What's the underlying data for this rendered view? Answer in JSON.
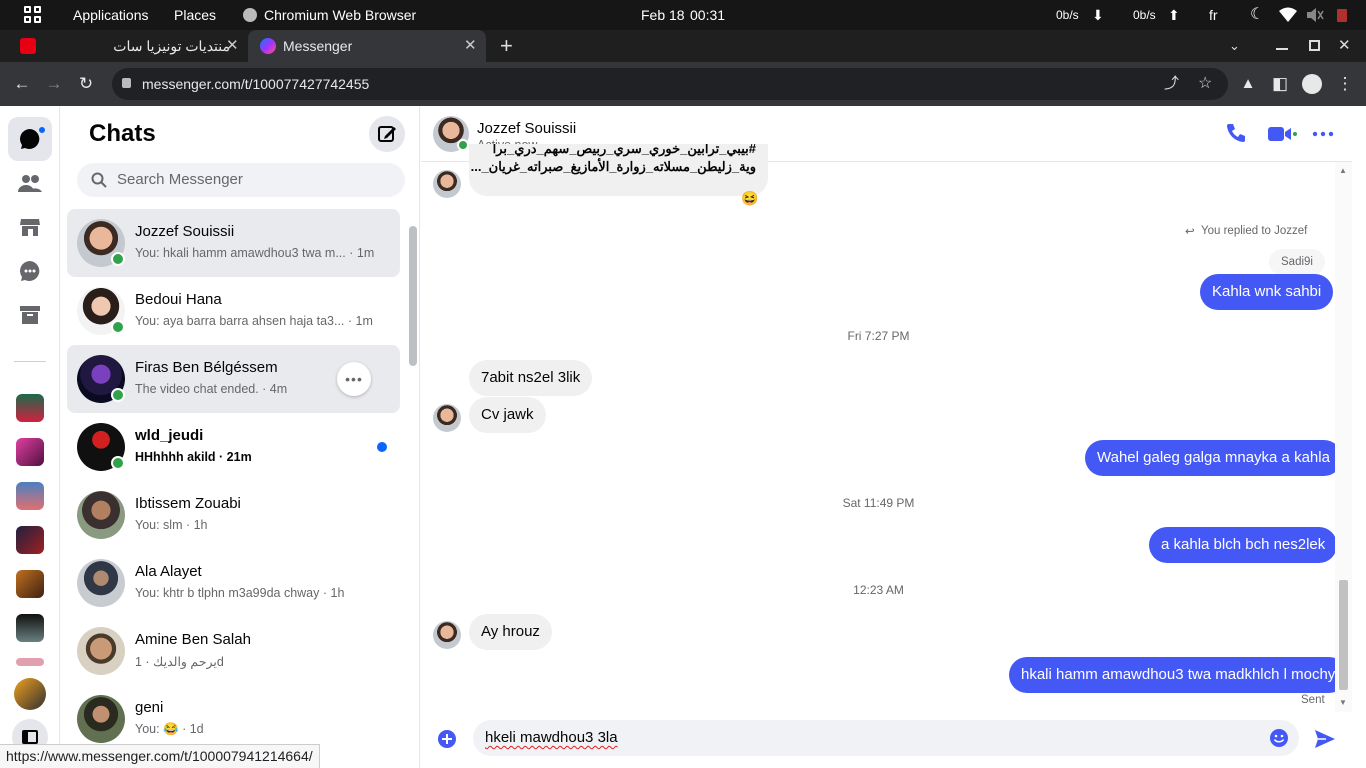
{
  "system_bar": {
    "applications": "Applications",
    "places": "Places",
    "active_app": "Chromium Web Browser",
    "date": "Feb 18",
    "time": "00:31",
    "net_down": "0b/s",
    "net_up": "0b/s",
    "keyboard_layout": "fr"
  },
  "browser": {
    "tabs": [
      {
        "title": "منتديات تونيزيا سات",
        "active": false
      },
      {
        "title": "Messenger",
        "active": true
      }
    ],
    "url": "messenger.com/t/100077427742455",
    "status_url": "https://www.messenger.com/t/100007941214664/"
  },
  "chats": {
    "title": "Chats",
    "search_placeholder": "Search Messenger",
    "items": [
      {
        "name": "Jozzef Souissii",
        "preview": "You: hkali hamm amawdhou3 twa m... · 1m",
        "online": true,
        "highlight": true
      },
      {
        "name": "Bedoui Hana",
        "preview": "You: aya barra barra ahsen haja ta3... · 1m",
        "online": true
      },
      {
        "name": "Firas Ben Bélgéssem",
        "preview": "The video chat ended. · 4m",
        "online": true,
        "hover": true
      },
      {
        "name": "wld_jeudi",
        "preview": "HHhhhh akild · 21m",
        "online": true,
        "unread": true
      },
      {
        "name": "Ibtissem Zouabi",
        "preview": "You: slm · 1h"
      },
      {
        "name": "Ala Alayet",
        "preview": "You: khtr b tlphn m3a99da chway · 1h"
      },
      {
        "name": "Amine Ben Salah",
        "preview": "يرحم والديك · 1d"
      },
      {
        "name": "geni",
        "preview": "You: 😂 · 1d"
      }
    ]
  },
  "thread": {
    "contact_name": "Jozzef Souissii",
    "contact_status": "Active now",
    "partial_message_line1": "#بيبي_ترابين_خوري_سري_ربيص_سهم_دري_برا",
    "partial_message_line2": "وية_زليطن_مسلاته_زوارة_الأمازيغ_صبراته_غريان_...",
    "partial_reaction": "😆",
    "replied_note": "You replied to Jozzef",
    "quoted": "Sadi9i",
    "messages": [
      {
        "text": "Kahla wnk sahbi",
        "dir": "out"
      },
      {
        "text": "7abit ns2el 3lik",
        "dir": "in"
      },
      {
        "text": "Cv jawk",
        "dir": "in"
      },
      {
        "text": "Wahel galeg galga mnayka a kahla",
        "dir": "out"
      },
      {
        "text": "a kahla blch bch nes2lek",
        "dir": "out"
      },
      {
        "text": "Ay hrouz",
        "dir": "in"
      },
      {
        "text": "hkali hamm amawdhou3 twa madkhlch l mochy",
        "dir": "out"
      }
    ],
    "timestamps": [
      "Fri 7:27 PM",
      "Sat 11:49 PM",
      "12:23 AM"
    ],
    "sent_label": "Sent",
    "composer_text": "hkeli mawdhou3 3la"
  },
  "colors": {
    "accent": "#4458f5",
    "online": "#31a24c",
    "unread": "#0866ff"
  }
}
